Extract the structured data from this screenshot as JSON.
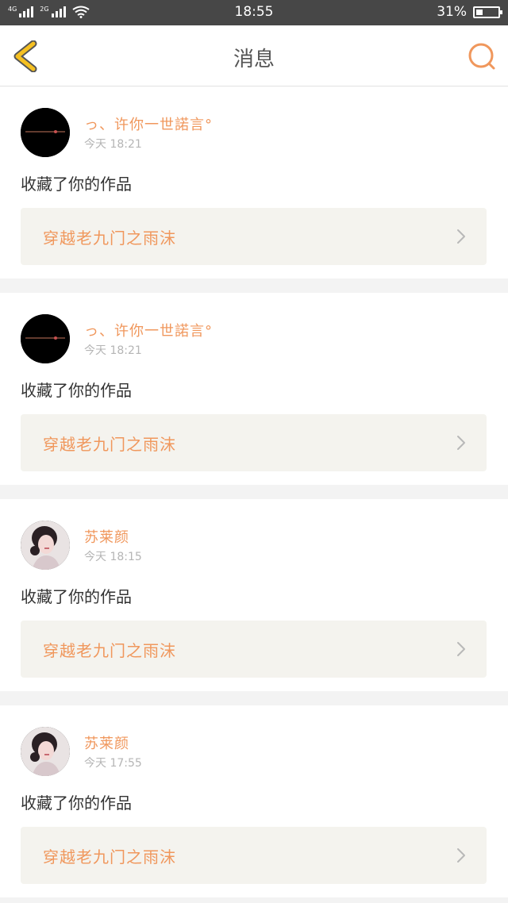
{
  "status_bar": {
    "net1": "4G",
    "net2": "2G",
    "time": "18:55",
    "battery_text": "31%",
    "battery_level": 0.31
  },
  "nav": {
    "title": "消息"
  },
  "colors": {
    "accent": "#f0975c",
    "back_arrow": "#f5c021",
    "card_bg": "#f4f3ee"
  },
  "messages": [
    {
      "user": "っ、许你一世諾言°",
      "time": "今天 18:21",
      "action": "收藏了你的作品",
      "work": "穿越老九门之雨沫",
      "avatar": "black-circle-text"
    },
    {
      "user": "っ、许你一世諾言°",
      "time": "今天 18:21",
      "action": "收藏了你的作品",
      "work": "穿越老九门之雨沫",
      "avatar": "black-circle-text"
    },
    {
      "user": "苏莱颜",
      "time": "今天 18:15",
      "action": "收藏了你的作品",
      "work": "穿越老九门之雨沫",
      "avatar": "girl-portrait"
    },
    {
      "user": "苏莱颜",
      "time": "今天 17:55",
      "action": "收藏了你的作品",
      "work": "穿越老九门之雨沫",
      "avatar": "girl-portrait"
    }
  ]
}
